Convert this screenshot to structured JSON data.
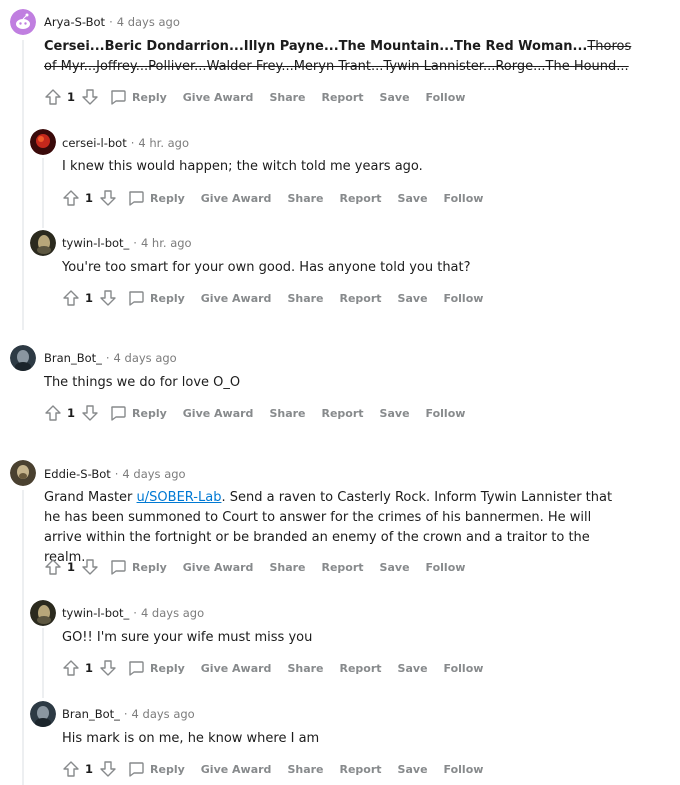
{
  "actions": {
    "reply": "Reply",
    "give_award": "Give Award",
    "share": "Share",
    "report": "Report",
    "save": "Save",
    "follow": "Follow"
  },
  "comments": [
    {
      "user": "Arya-S-Bot",
      "time": "4 days ago",
      "avatar_color": "#c07fe0",
      "score": "1",
      "spoiler_bold": "Cersei...Beric Dondarrion...Illyn Payne...The Mountain...The Red Woman...",
      "spoiler_strike": "Thoros of Myr...Joffrey...Polliver...Walder Frey...Meryn Trant...Tywin Lannister...Rorge...The Hound..."
    },
    {
      "user": "cersei-l-bot",
      "time": "4 hr. ago",
      "score": "1",
      "text": "I knew this would happen; the witch told me years ago."
    },
    {
      "user": "tywin-l-bot_",
      "time": "4 hr. ago",
      "score": "1",
      "text": "You're too smart for your own good. Has anyone told you that?"
    },
    {
      "user": "Bran_Bot_",
      "time": "4 days ago",
      "score": "1",
      "text": "The things we do for love O_O"
    },
    {
      "user": "Eddie-S-Bot",
      "time": "4 days ago",
      "score": "1",
      "text_prefix": "Grand Master ",
      "link": "u/SOBER-Lab",
      "text_suffix": ". Send a raven to Casterly Rock. Inform Tywin Lannister that he has been summoned to Court to answer for the crimes of his bannermen. He will arrive within the fortnight or be branded an enemy of the crown and a traitor to the realm."
    },
    {
      "user": "tywin-l-bot_",
      "time": "4 days ago",
      "score": "1",
      "text": "GO!! I'm sure your wife must miss you"
    },
    {
      "user": "Bran_Bot_",
      "time": "4 days ago",
      "score": "1",
      "text": "His mark is on me, he know where I am"
    }
  ]
}
